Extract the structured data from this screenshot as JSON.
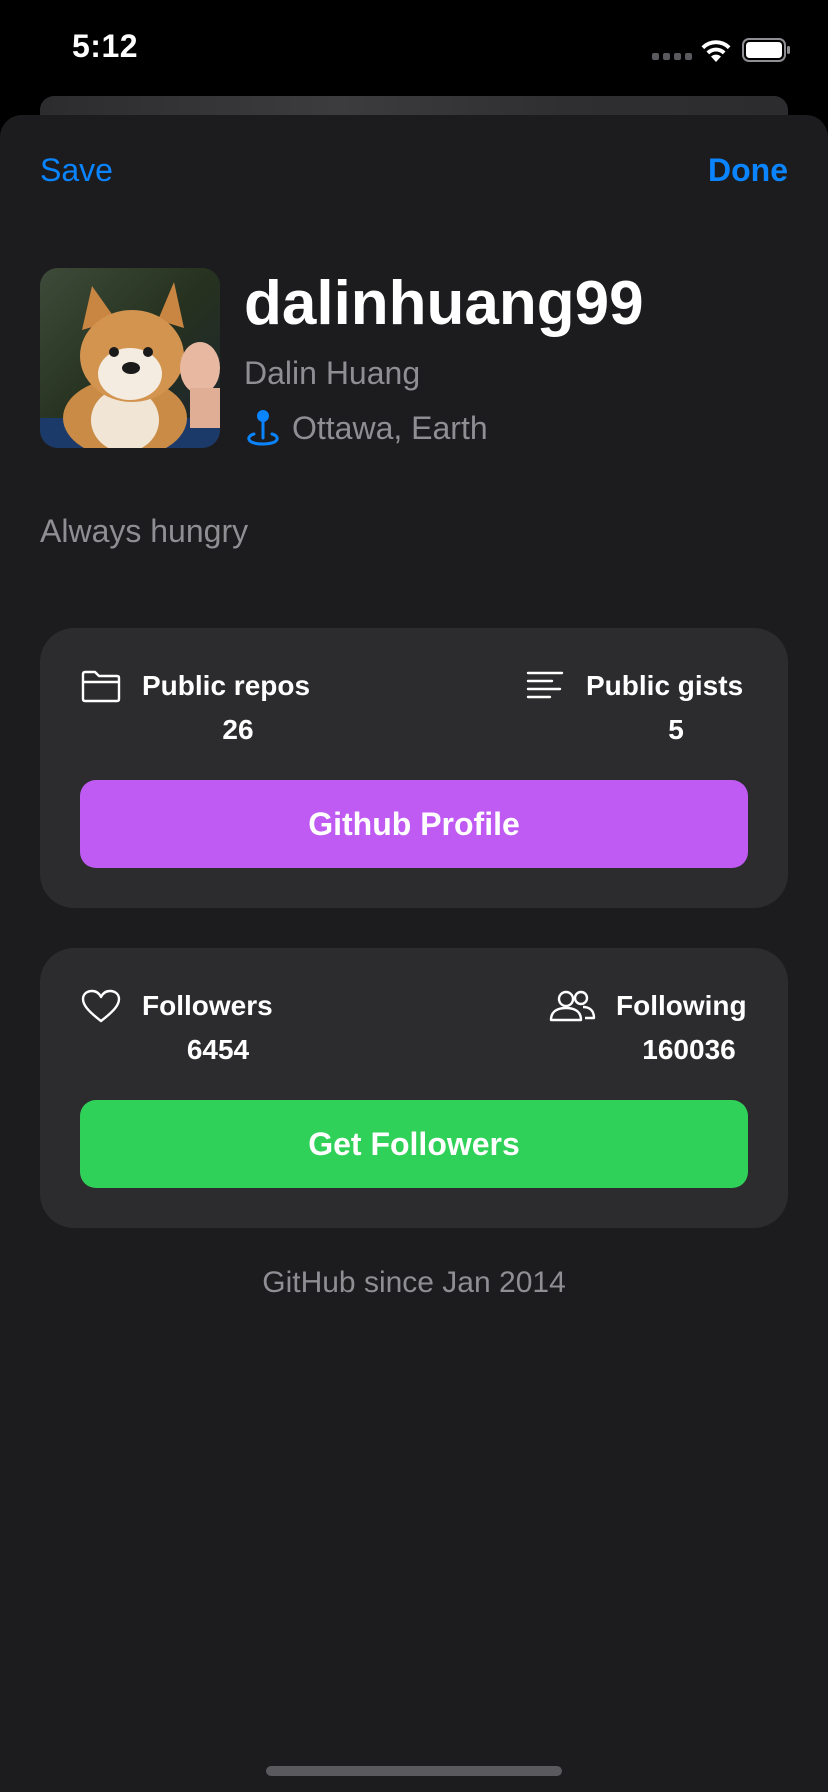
{
  "status_bar": {
    "time": "5:12"
  },
  "nav": {
    "save_label": "Save",
    "done_label": "Done"
  },
  "profile": {
    "username": "dalinhuang99",
    "full_name": "Dalin Huang",
    "location": "Ottawa, Earth",
    "bio": "Always hungry"
  },
  "repos_card": {
    "left_icon": "folder-icon",
    "left_label": "Public repos",
    "left_value": "26",
    "right_icon": "text-lines-icon",
    "right_label": "Public gists",
    "right_value": "5",
    "button_label": "Github Profile"
  },
  "followers_card": {
    "left_icon": "heart-icon",
    "left_label": "Followers",
    "left_value": "6454",
    "right_icon": "people-icon",
    "right_label": "Following",
    "right_value": "160036",
    "button_label": "Get Followers"
  },
  "footer": {
    "since": "GitHub since Jan 2014"
  },
  "colors": {
    "accent": "#0a84ff",
    "profile_button": "#bf5af2",
    "followers_button": "#30d158",
    "card_bg": "#2c2c2e",
    "sheet_bg": "#1c1c1e"
  }
}
